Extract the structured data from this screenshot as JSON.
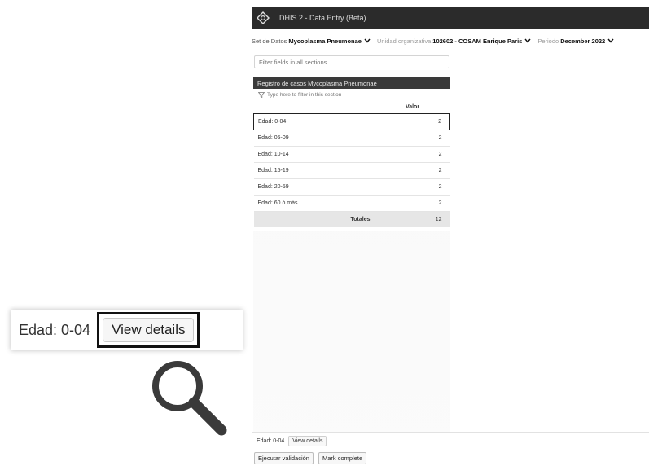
{
  "app": {
    "title": "DHIS 2 - Data Entry (Beta)"
  },
  "selectors": {
    "dataset_label": "Set de Datos",
    "dataset_value": "Mycoplasma Pneumonae",
    "orgunit_label": "Unidad organizativa",
    "orgunit_value": "102602 - COSAM Enrique Paris",
    "period_label": "Periodo",
    "period_value": "December 2022"
  },
  "filter_all": {
    "placeholder": "Filter fields in all sections"
  },
  "section": {
    "title": "Registro de casos Mycoplasma Pneumonae",
    "filter_placeholder": "Type here to filter in this section",
    "column_header": "Valor",
    "rows": [
      {
        "label": "Edad: 0-04",
        "value": "2"
      },
      {
        "label": "Edad: 05-09",
        "value": "2"
      },
      {
        "label": "Edad: 10-14",
        "value": "2"
      },
      {
        "label": "Edad: 15-19",
        "value": "2"
      },
      {
        "label": "Edad: 20-59",
        "value": "2"
      },
      {
        "label": "Edad: 60 ó más",
        "value": "2"
      }
    ],
    "totals_label": "Totales",
    "totals_value": "12"
  },
  "bottombar": {
    "selected_field": "Edad: 0-04",
    "view_details": "View details",
    "run_validation": "Ejecutar validación",
    "mark_complete": "Mark complete"
  },
  "callout": {
    "label": "Edad: 0-04",
    "button": "View details"
  },
  "colors": {
    "topbar": "#2b2b2b",
    "section_header": "#3a3a3a",
    "highlight_border": "#111111"
  }
}
